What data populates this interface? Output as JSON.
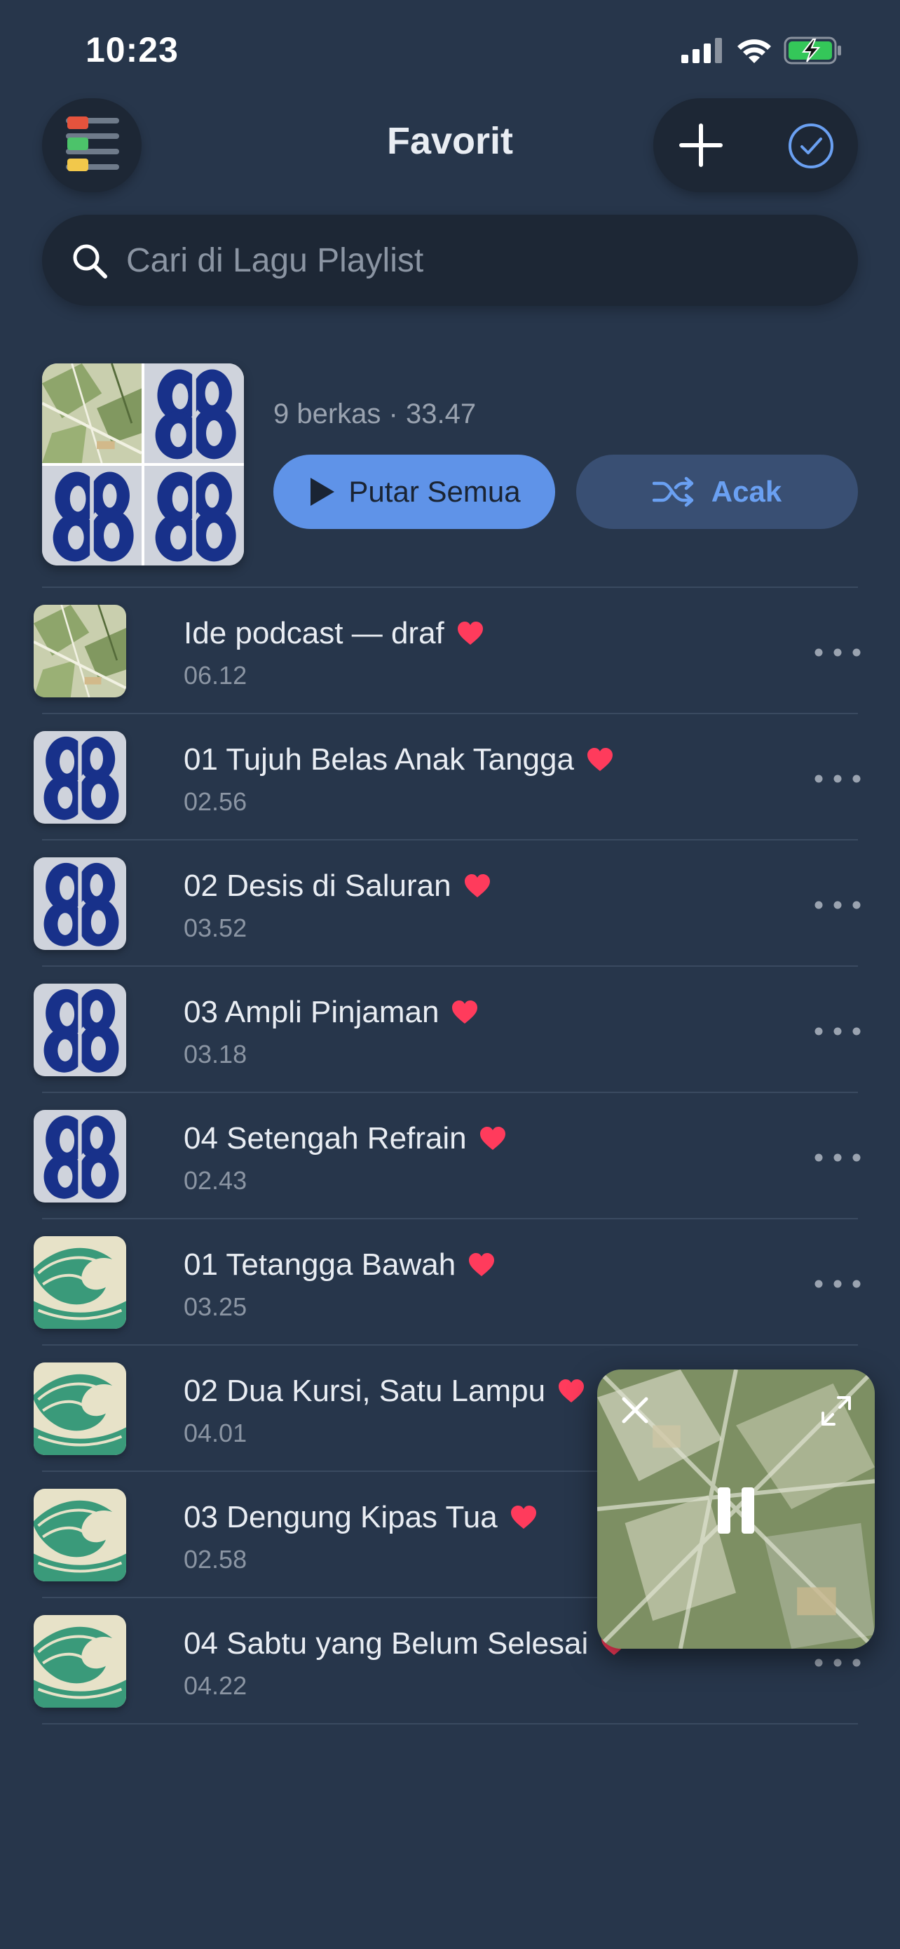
{
  "status_bar": {
    "time": "10:23"
  },
  "header": {
    "title": "Favorit"
  },
  "search": {
    "placeholder": "Cari di Lagu Playlist"
  },
  "summary": {
    "meta": "9 berkas · 33.47",
    "play_all_label": "Putar Semua",
    "shuffle_label": "Acak"
  },
  "tracks": [
    {
      "title": "Ide podcast — draf",
      "duration": "06.12",
      "art": "leaf-art",
      "favorite": true
    },
    {
      "title": "01 Tujuh Belas Anak Tangga",
      "duration": "02.56",
      "art": "eight-art",
      "favorite": true
    },
    {
      "title": "02 Desis di Saluran",
      "duration": "03.52",
      "art": "eight-art",
      "favorite": true
    },
    {
      "title": "03 Ampli Pinjaman",
      "duration": "03.18",
      "art": "eight-art",
      "favorite": true
    },
    {
      "title": "04 Setengah Refrain",
      "duration": "02.43",
      "art": "eight-art",
      "favorite": true
    },
    {
      "title": "01 Tetangga Bawah",
      "duration": "03.25",
      "art": "wave-art",
      "favorite": true
    },
    {
      "title": "02 Dua Kursi, Satu Lampu",
      "duration": "04.01",
      "art": "wave-art",
      "favorite": true
    },
    {
      "title": "03 Dengung Kipas Tua",
      "duration": "02.58",
      "art": "wave-art",
      "favorite": true
    },
    {
      "title": "04 Sabtu yang Belum Selesai",
      "duration": "04.22",
      "art": "wave-art",
      "favorite": true
    }
  ],
  "colors": {
    "background": "#27364b",
    "accent": "#5f93e8",
    "heart": "#ff3b5c",
    "surface": "#1d2735"
  }
}
